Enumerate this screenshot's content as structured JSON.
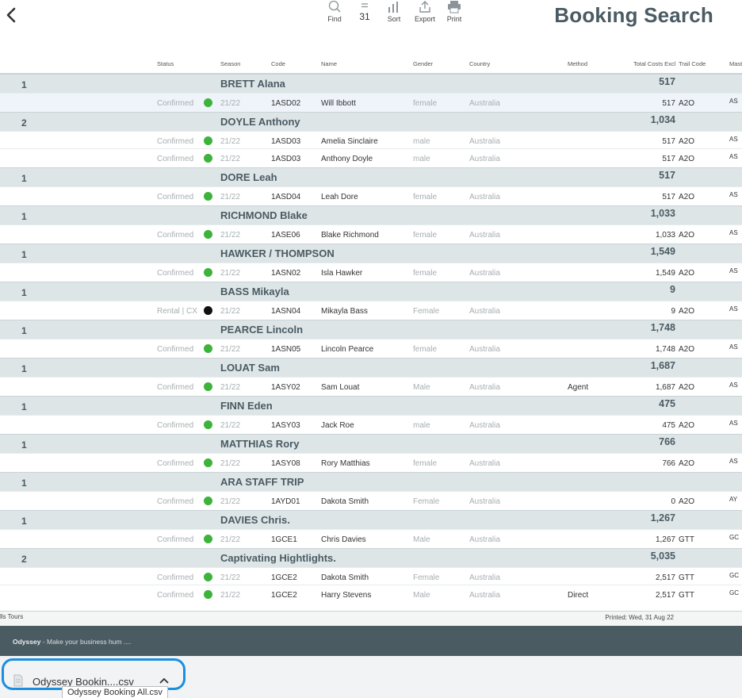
{
  "header": {
    "title": "Booking Search",
    "toolbar": {
      "find_label": "Find",
      "count": "31",
      "sort_label": "Sort",
      "export_label": "Export",
      "print_label": "Print"
    }
  },
  "columns": {
    "status": "Status",
    "season": "Season",
    "code": "Code",
    "name": "Name",
    "gender": "Gender",
    "country": "Country",
    "method": "Method",
    "total": "Total Costs Excl",
    "trail": "Trail Code",
    "mast": "Mast"
  },
  "groups": [
    {
      "count": "1",
      "name": "BRETT Alana",
      "total": "517",
      "rows": [
        {
          "status": "Confirmed",
          "dot": "green",
          "season": "21/22",
          "code": "1ASD02",
          "name": "Will Ibbott",
          "gender": "female",
          "country": "Australia",
          "method": "",
          "total": "517",
          "trail": "A2O",
          "mast": "AS",
          "selected": true
        }
      ]
    },
    {
      "count": "2",
      "name": "DOYLE Anthony",
      "total": "1,034",
      "rows": [
        {
          "status": "Confirmed",
          "dot": "green",
          "season": "21/22",
          "code": "1ASD03",
          "name": "Amelia Sinclaire",
          "gender": "male",
          "country": "Australia",
          "method": "",
          "total": "517",
          "trail": "A2O",
          "mast": "AS"
        },
        {
          "status": "Confirmed",
          "dot": "green",
          "season": "21/22",
          "code": "1ASD03",
          "name": "Anthony Doyle",
          "gender": "male",
          "country": "Australia",
          "method": "",
          "total": "517",
          "trail": "A2O",
          "mast": "AS"
        }
      ]
    },
    {
      "count": "1",
      "name": "DORE Leah",
      "total": "517",
      "rows": [
        {
          "status": "Confirmed",
          "dot": "green",
          "season": "21/22",
          "code": "1ASD04",
          "name": "Leah Dore",
          "gender": "female",
          "country": "Australia",
          "method": "",
          "total": "517",
          "trail": "A2O",
          "mast": "AS"
        }
      ]
    },
    {
      "count": "1",
      "name": "RICHMOND Blake",
      "total": "1,033",
      "rows": [
        {
          "status": "Confirmed",
          "dot": "green",
          "season": "21/22",
          "code": "1ASE06",
          "name": "Blake Richmond",
          "gender": "female",
          "country": "Australia",
          "method": "",
          "total": "1,033",
          "trail": "A2O",
          "mast": "AS"
        }
      ]
    },
    {
      "count": "1",
      "name": "HAWKER / THOMPSON",
      "total": "1,549",
      "rows": [
        {
          "status": "Confirmed",
          "dot": "green",
          "season": "21/22",
          "code": "1ASN02",
          "name": "Isla Hawker",
          "gender": "female",
          "country": "Australia",
          "method": "",
          "total": "1,549",
          "trail": "A2O",
          "mast": "AS"
        }
      ]
    },
    {
      "count": "1",
      "name": "BASS Mikayla",
      "total": "9",
      "rows": [
        {
          "status": "Rental | CX",
          "dot": "cx",
          "season": "21/22",
          "code": "1ASN04",
          "name": "Mikayla Bass",
          "gender": "Female",
          "country": "Australia",
          "method": "",
          "total": "9",
          "trail": "A2O",
          "mast": "AS"
        }
      ]
    },
    {
      "count": "1",
      "name": "PEARCE Lincoln",
      "total": "1,748",
      "rows": [
        {
          "status": "Confirmed",
          "dot": "green",
          "season": "21/22",
          "code": "1ASN05",
          "name": "Lincoln Pearce",
          "gender": "female",
          "country": "Australia",
          "method": "",
          "total": "1,748",
          "trail": "A2O",
          "mast": "AS"
        }
      ]
    },
    {
      "count": "1",
      "name": "LOUAT Sam",
      "total": "1,687",
      "rows": [
        {
          "status": "Confirmed",
          "dot": "green",
          "season": "21/22",
          "code": "1ASY02",
          "name": "Sam Louat",
          "gender": "Male",
          "country": "Australia",
          "method": "Agent",
          "total": "1,687",
          "trail": "A2O",
          "mast": "AS"
        }
      ]
    },
    {
      "count": "1",
      "name": "FINN Eden",
      "total": "475",
      "rows": [
        {
          "status": "Confirmed",
          "dot": "green",
          "season": "21/22",
          "code": "1ASY03",
          "name": "Jack Roe",
          "gender": "male",
          "country": "Australia",
          "method": "",
          "total": "475",
          "trail": "A2O",
          "mast": "AS"
        }
      ]
    },
    {
      "count": "1",
      "name": "MATTHIAS Rory",
      "total": "766",
      "rows": [
        {
          "status": "Confirmed",
          "dot": "green",
          "season": "21/22",
          "code": "1ASY08",
          "name": "Rory Matthias",
          "gender": "female",
          "country": "Australia",
          "method": "",
          "total": "766",
          "trail": "A2O",
          "mast": "AS"
        }
      ]
    },
    {
      "count": "1",
      "name": "ARA STAFF TRIP",
      "total": "",
      "rows": [
        {
          "status": "Confirmed",
          "dot": "green",
          "season": "21/22",
          "code": "1AYD01",
          "name": "Dakota Smith",
          "gender": "Female",
          "country": "Australia",
          "method": "",
          "total": "0",
          "trail": "A2O",
          "mast": "AY"
        }
      ]
    },
    {
      "count": "1",
      "name": "DAVIES Chris.",
      "total": "1,267",
      "rows": [
        {
          "status": "Confirmed",
          "dot": "green",
          "season": "21/22",
          "code": "1GCE1",
          "name": "Chris Davies",
          "gender": "Male",
          "country": "Australia",
          "method": "",
          "total": "1,267",
          "trail": "GTT",
          "mast": "GC"
        }
      ]
    },
    {
      "count": "2",
      "name": "Captivating Hightlights.",
      "total": "5,035",
      "rows": [
        {
          "status": "Confirmed",
          "dot": "green",
          "season": "21/22",
          "code": "1GCE2",
          "name": "Dakota Smith",
          "gender": "Female",
          "country": "Australia",
          "method": "",
          "total": "2,517",
          "trail": "GTT",
          "mast": "GC"
        },
        {
          "status": "Confirmed",
          "dot": "green",
          "season": "21/22",
          "code": "1GCE2",
          "name": "Harry Stevens",
          "gender": "Male",
          "country": "Australia",
          "method": "Direct",
          "total": "2,517",
          "trail": "GTT",
          "mast": "GC"
        }
      ]
    }
  ],
  "footer": {
    "left": "lls Tours",
    "printed": "Printed: Wed, 31 Aug 22"
  },
  "brand": {
    "name": "Odyssey",
    "tagline": " - Make your business hum ...."
  },
  "downloads": {
    "file_label": "Odyssey Bookin....csv",
    "tooltip": "Odyssey Booking All.csv"
  },
  "colors": {
    "title": "#4a5b63",
    "group_bg": "#dde5e7",
    "status_green": "#3db33b",
    "brand_bar": "#4b5b62",
    "focus_ring": "#1a8fe0"
  }
}
